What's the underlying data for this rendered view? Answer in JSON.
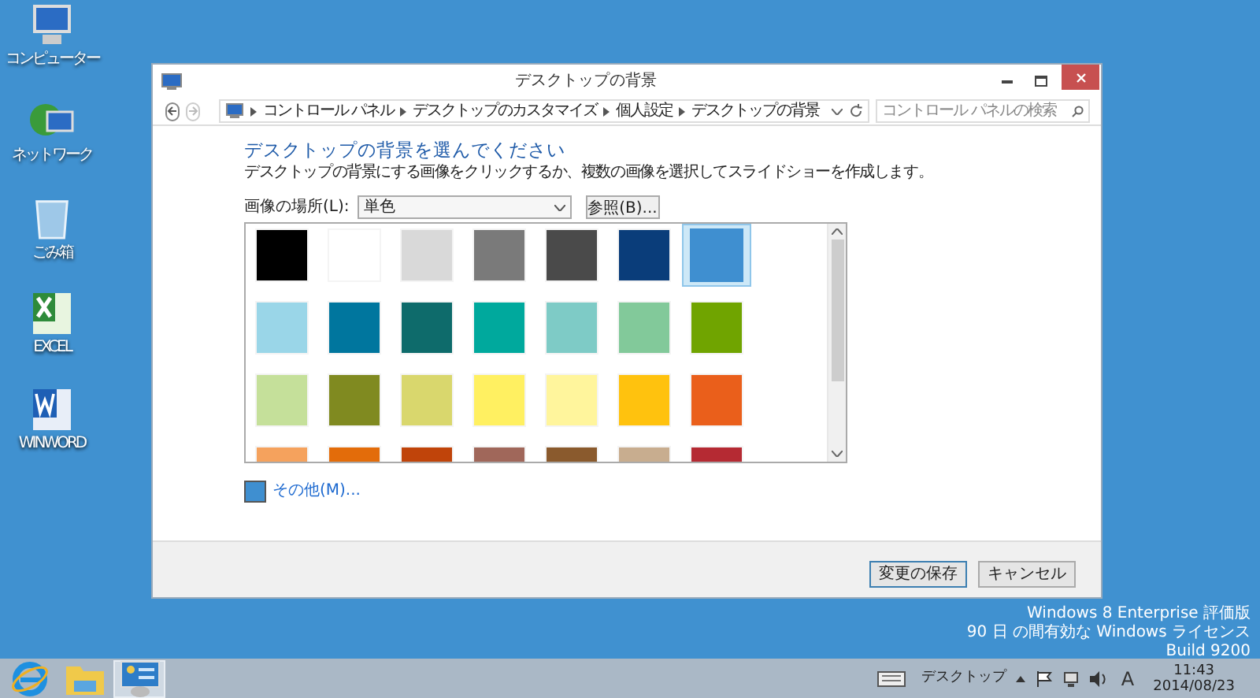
{
  "desktop_icons": [
    {
      "label": "コンピューター",
      "kind": "computer"
    },
    {
      "label": "ネットワーク",
      "kind": "network"
    },
    {
      "label": "ごみ箱",
      "kind": "trash"
    },
    {
      "label": "EXCEL",
      "kind": "excel"
    },
    {
      "label": "WINWORD",
      "kind": "word"
    }
  ],
  "window": {
    "title": "デスクトップの背景",
    "breadcrumbs": [
      "コントロール パネル",
      "デスクトップのカスタマイズ",
      "個人設定",
      "デスクトップの背景"
    ],
    "search": {
      "placeholder": "コントロール パネルの検索"
    },
    "heading": "デスクトップの背景を選んでください",
    "description": "デスクトップの背景にする画像をクリックするか、複数の画像を選択してスライドショーを作成します。",
    "location_label": "画像の場所(L):",
    "location_value": "単色",
    "browse_button": "参照(B)...",
    "swatches": [
      {
        "color": "#000000",
        "selected": false
      },
      {
        "color": "#ffffff",
        "selected": false
      },
      {
        "color": "#d9d9d9",
        "selected": false
      },
      {
        "color": "#7a7a7a",
        "selected": false
      },
      {
        "color": "#4a4a4a",
        "selected": false
      },
      {
        "color": "#0a3d7a",
        "selected": false
      },
      {
        "color": "#3f8fd0",
        "selected": true
      },
      {
        "color": "#9ad6e8",
        "selected": false
      },
      {
        "color": "#00769e",
        "selected": false
      },
      {
        "color": "#0e6b6b",
        "selected": false
      },
      {
        "color": "#00a99d",
        "selected": false
      },
      {
        "color": "#7ecbc6",
        "selected": false
      },
      {
        "color": "#82c99a",
        "selected": false
      },
      {
        "color": "#70a400",
        "selected": false
      },
      {
        "color": "#c5e09a",
        "selected": false
      },
      {
        "color": "#808a20",
        "selected": false
      },
      {
        "color": "#d9d76d",
        "selected": false
      },
      {
        "color": "#fff061",
        "selected": false
      },
      {
        "color": "#fff59c",
        "selected": false
      },
      {
        "color": "#ffc20e",
        "selected": false
      },
      {
        "color": "#ea5f1b",
        "selected": false
      },
      {
        "color": "#f5a25d",
        "selected": false
      },
      {
        "color": "#e36c0a",
        "selected": false
      },
      {
        "color": "#c0440a",
        "selected": false
      },
      {
        "color": "#a0675a",
        "selected": false
      },
      {
        "color": "#8a5a2d",
        "selected": false
      },
      {
        "color": "#c8ad8f",
        "selected": false
      },
      {
        "color": "#b52a33",
        "selected": false
      }
    ],
    "other_color": {
      "label": "その他(M)...",
      "color": "#3f8fd0"
    },
    "buttons": [
      "変更の保存",
      "キャンセル"
    ]
  },
  "watermark_lines": [
    "Windows 8 Enterprise 評価版",
    "90 日 の間有効な Windows ライセンス",
    "Build 9200"
  ],
  "taskbar": {
    "apps": [
      {
        "kind": "ie",
        "selected": false
      },
      {
        "kind": "explorer",
        "selected": false
      },
      {
        "kind": "control",
        "selected": true
      }
    ],
    "toolbar_label": "デスクトップ",
    "ime": "A",
    "time": "11:43",
    "date": "2014/08/23"
  }
}
